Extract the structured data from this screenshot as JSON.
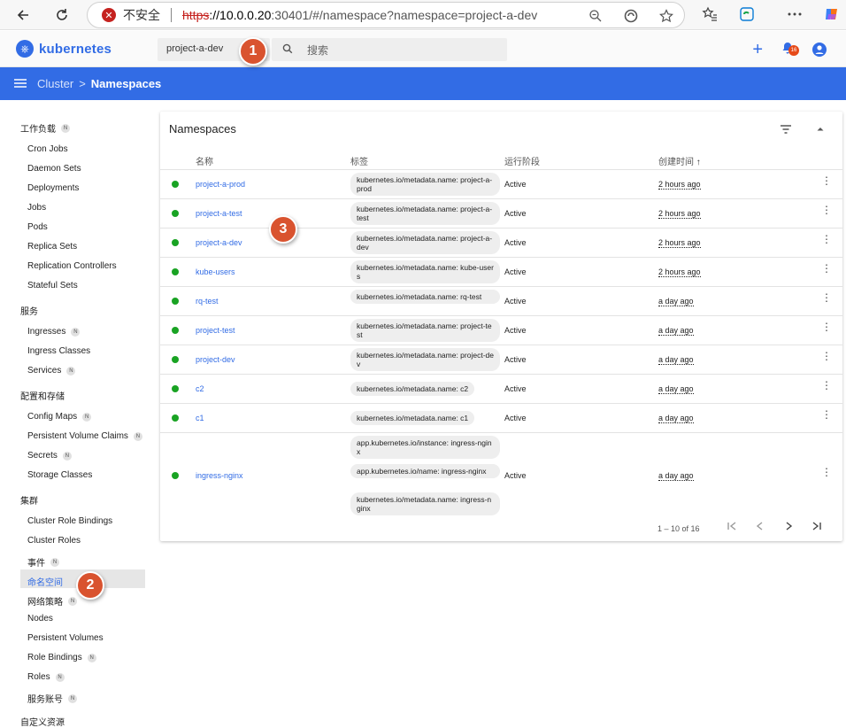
{
  "browser": {
    "insecure_label": "不安全",
    "url_scheme": "https",
    "url_host": "://10.0.0.20",
    "url_rest": ":30401/#/namespace?namespace=project-a-dev"
  },
  "header": {
    "logo_text": "kubernetes",
    "namespace_selected": "project-a-dev",
    "search_placeholder": "搜索",
    "notification_count": "16"
  },
  "toolbar": {
    "breadcrumb_parent": "Cluster",
    "breadcrumb_sep": ">",
    "breadcrumb_current": "Namespaces"
  },
  "sidebar": {
    "groups": [
      {
        "label": "工作负载",
        "badge": "N"
      },
      {
        "label": "服务"
      },
      {
        "label": "配置和存储"
      },
      {
        "label": "集群"
      },
      {
        "label": "自定义资源"
      }
    ],
    "items": [
      {
        "label": "Cron Jobs"
      },
      {
        "label": "Daemon Sets"
      },
      {
        "label": "Deployments"
      },
      {
        "label": "Jobs"
      },
      {
        "label": "Pods"
      },
      {
        "label": "Replica Sets"
      },
      {
        "label": "Replication Controllers"
      },
      {
        "label": "Stateful Sets"
      },
      {
        "label": "Ingresses",
        "badge": "N"
      },
      {
        "label": "Ingress Classes"
      },
      {
        "label": "Services",
        "badge": "N"
      },
      {
        "label": "Config Maps",
        "badge": "N"
      },
      {
        "label": "Persistent Volume Claims",
        "badge": "N"
      },
      {
        "label": "Secrets",
        "badge": "N"
      },
      {
        "label": "Storage Classes"
      },
      {
        "label": "Cluster Role Bindings"
      },
      {
        "label": "Cluster Roles"
      },
      {
        "label": "事件",
        "badge": "N"
      },
      {
        "label": "命名空间"
      },
      {
        "label": "网络策略",
        "badge": "N"
      },
      {
        "label": "Nodes"
      },
      {
        "label": "Persistent Volumes"
      },
      {
        "label": "Role Bindings",
        "badge": "N"
      },
      {
        "label": "Roles",
        "badge": "N"
      },
      {
        "label": "服务账号",
        "badge": "N"
      }
    ]
  },
  "card": {
    "title": "Namespaces",
    "columns": {
      "name": "名称",
      "labels": "标签",
      "phase": "运行阶段",
      "created": "创建时间",
      "sort_arrow": "↑"
    },
    "rows": [
      {
        "name": "project-a-prod",
        "labels": [
          "kubernetes.io/metadata.name: project-a-prod"
        ],
        "phase": "Active",
        "created": "2 hours ago"
      },
      {
        "name": "project-a-test",
        "labels": [
          "kubernetes.io/metadata.name: project-a-test"
        ],
        "phase": "Active",
        "created": "2 hours ago"
      },
      {
        "name": "project-a-dev",
        "labels": [
          "kubernetes.io/metadata.name: project-a-dev"
        ],
        "phase": "Active",
        "created": "2 hours ago"
      },
      {
        "name": "kube-users",
        "labels": [
          "kubernetes.io/metadata.name: kube-users"
        ],
        "phase": "Active",
        "created": "2 hours ago"
      },
      {
        "name": "rq-test",
        "labels": [
          "kubernetes.io/metadata.name: rq-test"
        ],
        "phase": "Active",
        "created": "a day ago"
      },
      {
        "name": "project-test",
        "labels": [
          "kubernetes.io/metadata.name: project-test"
        ],
        "phase": "Active",
        "created": "a day ago"
      },
      {
        "name": "project-dev",
        "labels": [
          "kubernetes.io/metadata.name: project-dev"
        ],
        "phase": "Active",
        "created": "a day ago"
      },
      {
        "name": "c2",
        "labels": [
          "kubernetes.io/metadata.name: c2"
        ],
        "phase": "Active",
        "created": "a day ago"
      },
      {
        "name": "c1",
        "labels": [
          "kubernetes.io/metadata.name: c1"
        ],
        "phase": "Active",
        "created": "a day ago"
      },
      {
        "name": "ingress-nginx",
        "labels": [
          "app.kubernetes.io/instance: ingress-nginx",
          "app.kubernetes.io/name: ingress-nginx",
          "kubernetes.io/metadata.name: ingress-nginx"
        ],
        "phase": "Active",
        "created": "a day ago"
      }
    ],
    "pagination": "1 – 10 of 16"
  },
  "markers": [
    "1",
    "2",
    "3"
  ],
  "colors": {
    "accent": "#326ce5",
    "status_active": "#19a323",
    "marker": "#d9532f"
  }
}
